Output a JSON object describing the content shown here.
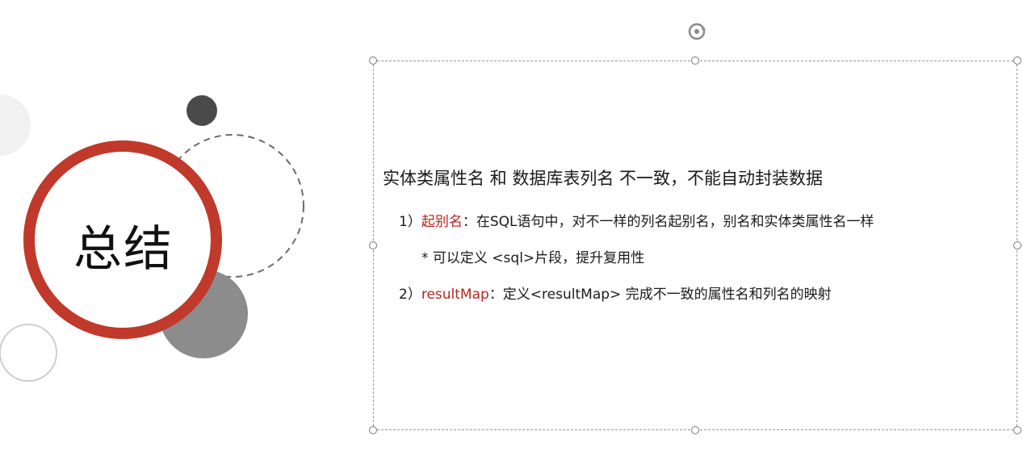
{
  "slide": {
    "title": "总结",
    "heading": "实体类属性名 和 数据库表列名 不一致，不能自动封装数据",
    "items": [
      {
        "number": "1）",
        "keyword": "起别名",
        "text": "：在SQL语句中，对不一样的列名起别名，别名和实体类属性名一样"
      },
      {
        "text": "* 可以定义 <sql>片段，提升复用性"
      },
      {
        "number": "2）",
        "keyword": "resultMap",
        "text": "：定义<resultMap> 完成不一致的属性名和列名的映射"
      }
    ]
  },
  "colors": {
    "accent_red": "#c0392b",
    "keyword_red": "#b0271f",
    "dark_dot": "#4a4a4a",
    "gray_circle": "#8c8c8c"
  },
  "icons": {
    "rotate": "rotate-handle-icon"
  }
}
